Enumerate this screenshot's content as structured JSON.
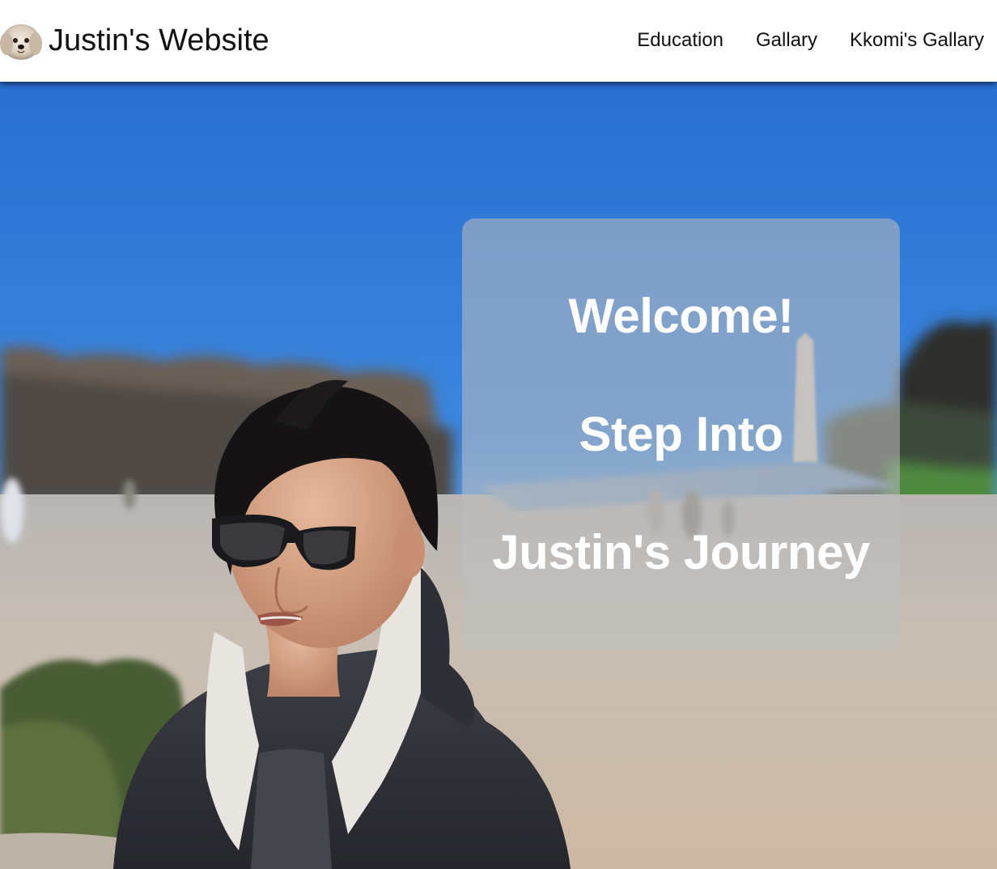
{
  "site": {
    "brand_text": "Justin's Website",
    "brand_logo_icon": "dog-face-icon"
  },
  "nav": {
    "items": [
      {
        "label": "Education"
      },
      {
        "label": "Gallary"
      },
      {
        "label": "Kkomi's Gallary"
      }
    ]
  },
  "hero": {
    "photo_icon": "hero-photo",
    "card": {
      "line1": "Welcome!",
      "line2": "Step Into",
      "line3": "Justin's Journey"
    }
  },
  "colors": {
    "sky": "#2f7ad6",
    "card_bg": "rgba(190,190,190,0.55)",
    "text_on_card": "#ffffff",
    "nav_bg": "#ffffff"
  }
}
